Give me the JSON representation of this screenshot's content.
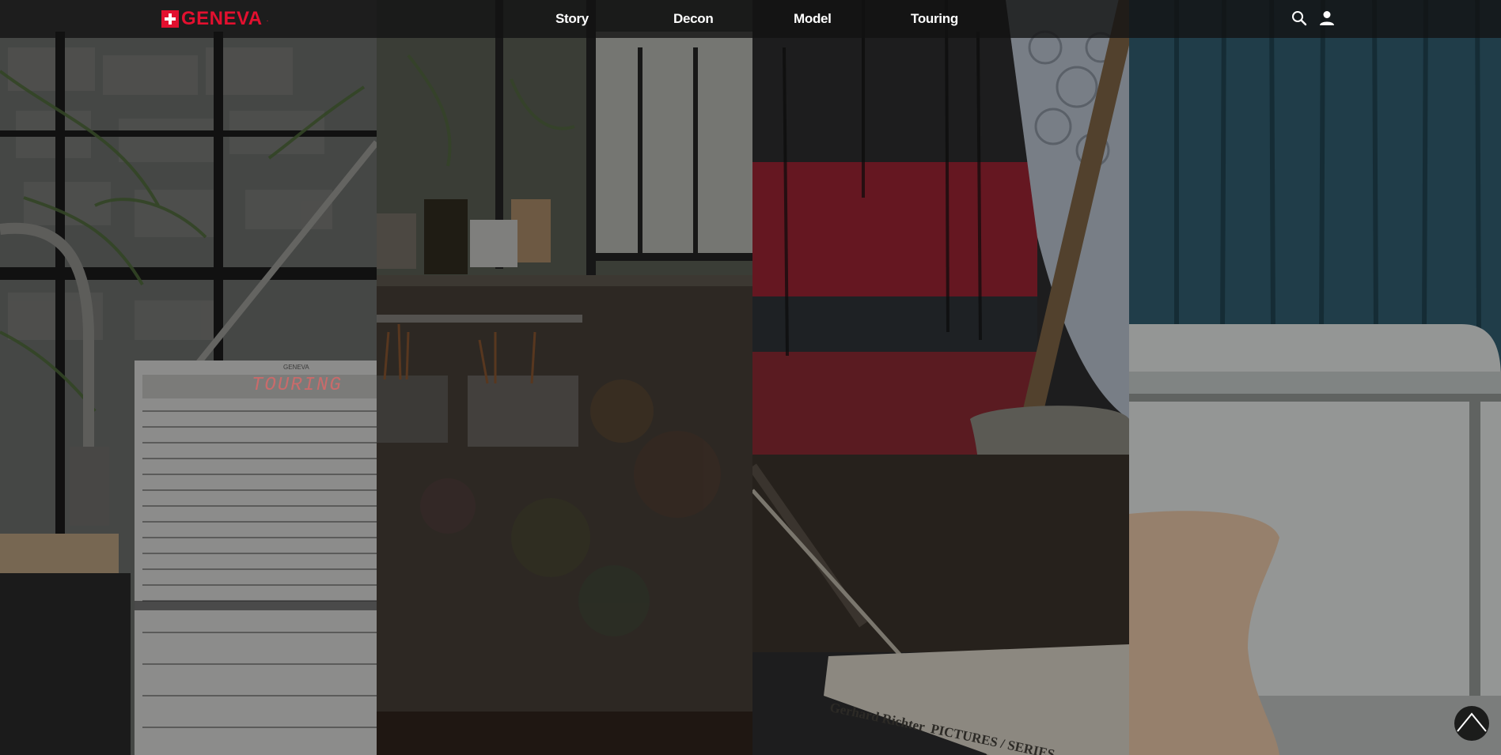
{
  "brand": {
    "name": "GENEVA",
    "registered": "."
  },
  "nav": {
    "links": [
      {
        "label": "Story"
      },
      {
        "label": "Decon"
      },
      {
        "label": "Model"
      },
      {
        "label": "Touring"
      }
    ]
  },
  "icons": {
    "search": "search-icon",
    "account": "user-icon",
    "scroll_top": "chevron-up-icon"
  },
  "panels": {
    "touring": {
      "speaker_brand": "GENEVA",
      "display_text": "TOURING"
    },
    "model": {
      "book_title": "Gerhard Richter  PICTURES / SERIES"
    }
  },
  "colors": {
    "brand_red": "#e3102f",
    "nav_bg": "#121212"
  }
}
